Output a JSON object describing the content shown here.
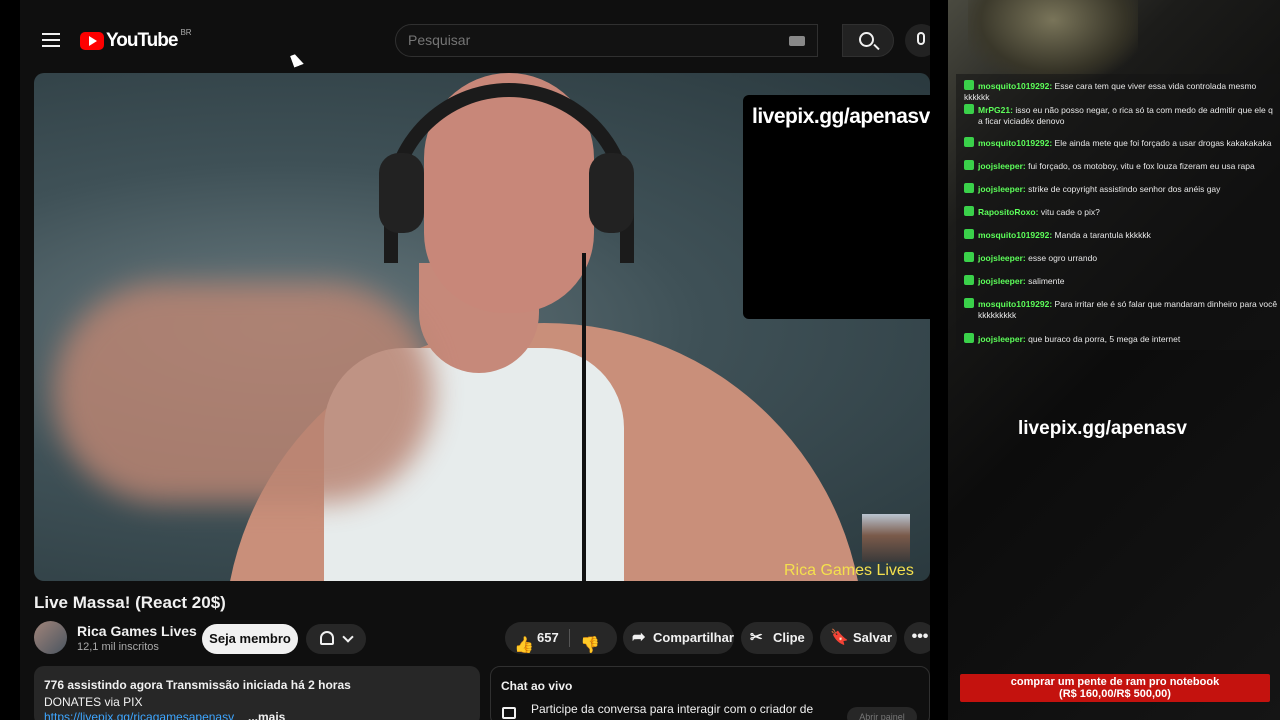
{
  "header": {
    "logo_text": "YouTube",
    "logo_region": "BR",
    "search_placeholder": "Pesquisar"
  },
  "video": {
    "overlay_link": "livepix.gg/apenasv",
    "channel_watermark": "Rica Games Lives"
  },
  "details": {
    "title": "Live Massa! (React 20$)",
    "channel_name": "Rica Games Lives",
    "subscribers": "12,1 mil inscritos",
    "join_label": "Seja membro",
    "like_count": "657",
    "share_label": "Compartilhar",
    "clip_label": "Clipe",
    "save_label": "Salvar",
    "more_label": "•••"
  },
  "description": {
    "stats": "776 assistindo agora  Transmissão iniciada há 2 horas",
    "line2": "DONATES via PIX",
    "link": "https://livepix.gg/ricagamesapenasv",
    "more": "...mais"
  },
  "live_chat": {
    "title": "Chat ao vivo",
    "join_text": "Participe da conversa para interagir com o criador de",
    "action": "Abrir painel"
  },
  "overlay_chat": {
    "messages": [
      {
        "user": "mosquito1019292:",
        "text": "Esse cara tem que viver essa vida controlada mesmo kkkkkk",
        "cont": ""
      },
      {
        "user": "MrPG21:",
        "text": "isso eu não posso negar, o rica só ta com medo de admitir que ele q",
        "cont": "a ficar viciadéx denovo"
      },
      {
        "user": "mosquito1019292:",
        "text": "Ele ainda mete que foi forçado a usar drogas kakakakaka",
        "cont": ""
      },
      {
        "user": "joojsleeper:",
        "text": "fui forçado, os motoboy, vitu e fox louza fizeram eu usa rapa",
        "cont": ""
      },
      {
        "user": "joojsleeper:",
        "text": "strike de copyright assistindo senhor dos anéis gay",
        "cont": ""
      },
      {
        "user": "RapositoRoxo:",
        "text": "vitu cade o pix?",
        "cont": ""
      },
      {
        "user": "mosquito1019292:",
        "text": "Manda a tarantula kkkkkk",
        "cont": ""
      },
      {
        "user": "joojsleeper:",
        "text": "esse ogro urrando",
        "cont": ""
      },
      {
        "user": "joojsleeper:",
        "text": "salimente",
        "cont": ""
      },
      {
        "user": "mosquito1019292:",
        "text": "Para irritar ele é só falar que mandaram dinheiro para você r",
        "cont": "kkkkkkkkk"
      },
      {
        "user": "joojsleeper:",
        "text": "que buraco da porra, 5 mega de internet",
        "cont": ""
      }
    ],
    "overlay_link": "livepix.gg/apenasv",
    "donation_line1": "comprar um pente de ram pro notebook",
    "donation_line2": "(R$ 160,00/R$ 500,00)",
    "donation_progress": 0.32
  }
}
